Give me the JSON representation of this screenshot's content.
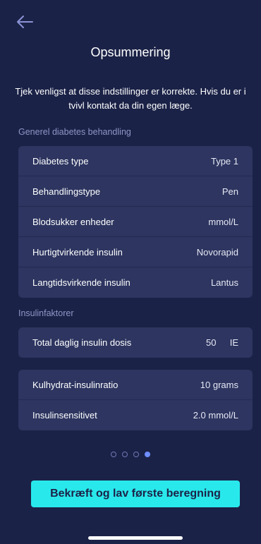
{
  "header": {
    "back_icon": "arrow-left-icon",
    "title": "Opsummering"
  },
  "intro_text": "Tjek venligst at disse indstillinger er korrekte. Hvis du er i tvivl kontakt da din egen læge.",
  "sections": {
    "general": {
      "label": "Generel diabetes behandling",
      "rows": [
        {
          "label": "Diabetes type",
          "value": "Type 1"
        },
        {
          "label": "Behandlingstype",
          "value": "Pen"
        },
        {
          "label": "Blodsukker enheder",
          "value": "mmol/L"
        },
        {
          "label": "Hurtigtvirkende insulin",
          "value": "Novorapid"
        },
        {
          "label": "Langtidsvirkende insulin",
          "value": "Lantus"
        }
      ]
    },
    "factors": {
      "label": "Insulinfaktorer",
      "total_dose": {
        "label": "Total daglig insulin dosis",
        "value": "50",
        "unit": "IE"
      },
      "rows": [
        {
          "label": "Kulhydrat-insulinratio",
          "value": "10 grams"
        },
        {
          "label": "Insulinsensitivet",
          "value": "2.0 mmol/L"
        }
      ]
    }
  },
  "pagination": {
    "total": 4,
    "current": 4
  },
  "cta_label": "Bekræft og lav første beregning",
  "colors": {
    "background": "#1b2247",
    "card": "#2d3560",
    "accent": "#29e8ec",
    "section_label": "#8e96c7",
    "active_dot": "#6f8fff"
  }
}
